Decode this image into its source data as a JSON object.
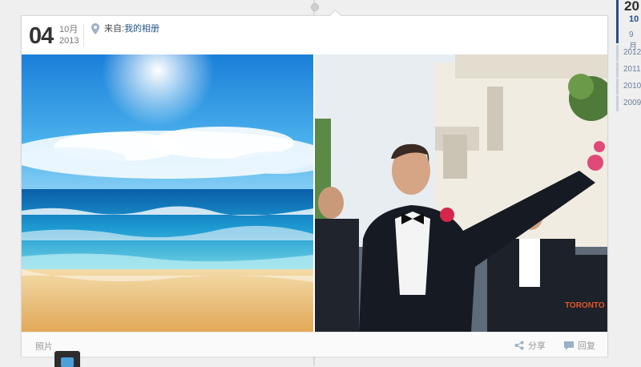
{
  "post": {
    "day": "04",
    "month": "10月",
    "year": "2013",
    "source_prefix": "来自:",
    "source_link": "我的相册",
    "type_label": "照片",
    "share_label": "分享",
    "reply_label": "回复"
  },
  "photos": [
    {
      "subject": "beach-sea-sky"
    },
    {
      "subject": "wedding-groom-pointing",
      "watermark": "TORONTO"
    }
  ],
  "sidebar": {
    "current_year": "20",
    "active_month": "10",
    "other_month": "9 月",
    "years": [
      "2012",
      "2011",
      "2010",
      "2009"
    ]
  },
  "colors": {
    "accent": "#234f86",
    "link": "#23548c"
  }
}
